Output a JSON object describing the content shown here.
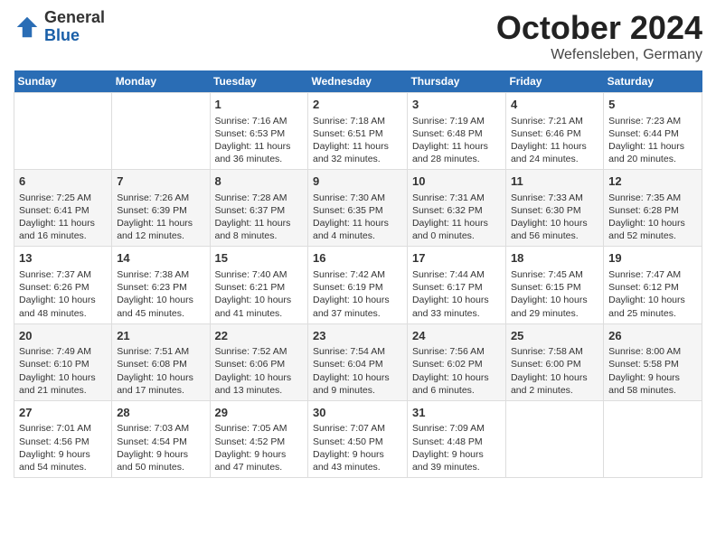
{
  "header": {
    "logo": {
      "general": "General",
      "blue": "Blue"
    },
    "title": "October 2024",
    "subtitle": "Wefensleben, Germany"
  },
  "weekdays": [
    "Sunday",
    "Monday",
    "Tuesday",
    "Wednesday",
    "Thursday",
    "Friday",
    "Saturday"
  ],
  "weeks": [
    [
      {
        "day": "",
        "info": ""
      },
      {
        "day": "",
        "info": ""
      },
      {
        "day": "1",
        "info": "Sunrise: 7:16 AM\nSunset: 6:53 PM\nDaylight: 11 hours and 36 minutes."
      },
      {
        "day": "2",
        "info": "Sunrise: 7:18 AM\nSunset: 6:51 PM\nDaylight: 11 hours and 32 minutes."
      },
      {
        "day": "3",
        "info": "Sunrise: 7:19 AM\nSunset: 6:48 PM\nDaylight: 11 hours and 28 minutes."
      },
      {
        "day": "4",
        "info": "Sunrise: 7:21 AM\nSunset: 6:46 PM\nDaylight: 11 hours and 24 minutes."
      },
      {
        "day": "5",
        "info": "Sunrise: 7:23 AM\nSunset: 6:44 PM\nDaylight: 11 hours and 20 minutes."
      }
    ],
    [
      {
        "day": "6",
        "info": "Sunrise: 7:25 AM\nSunset: 6:41 PM\nDaylight: 11 hours and 16 minutes."
      },
      {
        "day": "7",
        "info": "Sunrise: 7:26 AM\nSunset: 6:39 PM\nDaylight: 11 hours and 12 minutes."
      },
      {
        "day": "8",
        "info": "Sunrise: 7:28 AM\nSunset: 6:37 PM\nDaylight: 11 hours and 8 minutes."
      },
      {
        "day": "9",
        "info": "Sunrise: 7:30 AM\nSunset: 6:35 PM\nDaylight: 11 hours and 4 minutes."
      },
      {
        "day": "10",
        "info": "Sunrise: 7:31 AM\nSunset: 6:32 PM\nDaylight: 11 hours and 0 minutes."
      },
      {
        "day": "11",
        "info": "Sunrise: 7:33 AM\nSunset: 6:30 PM\nDaylight: 10 hours and 56 minutes."
      },
      {
        "day": "12",
        "info": "Sunrise: 7:35 AM\nSunset: 6:28 PM\nDaylight: 10 hours and 52 minutes."
      }
    ],
    [
      {
        "day": "13",
        "info": "Sunrise: 7:37 AM\nSunset: 6:26 PM\nDaylight: 10 hours and 48 minutes."
      },
      {
        "day": "14",
        "info": "Sunrise: 7:38 AM\nSunset: 6:23 PM\nDaylight: 10 hours and 45 minutes."
      },
      {
        "day": "15",
        "info": "Sunrise: 7:40 AM\nSunset: 6:21 PM\nDaylight: 10 hours and 41 minutes."
      },
      {
        "day": "16",
        "info": "Sunrise: 7:42 AM\nSunset: 6:19 PM\nDaylight: 10 hours and 37 minutes."
      },
      {
        "day": "17",
        "info": "Sunrise: 7:44 AM\nSunset: 6:17 PM\nDaylight: 10 hours and 33 minutes."
      },
      {
        "day": "18",
        "info": "Sunrise: 7:45 AM\nSunset: 6:15 PM\nDaylight: 10 hours and 29 minutes."
      },
      {
        "day": "19",
        "info": "Sunrise: 7:47 AM\nSunset: 6:12 PM\nDaylight: 10 hours and 25 minutes."
      }
    ],
    [
      {
        "day": "20",
        "info": "Sunrise: 7:49 AM\nSunset: 6:10 PM\nDaylight: 10 hours and 21 minutes."
      },
      {
        "day": "21",
        "info": "Sunrise: 7:51 AM\nSunset: 6:08 PM\nDaylight: 10 hours and 17 minutes."
      },
      {
        "day": "22",
        "info": "Sunrise: 7:52 AM\nSunset: 6:06 PM\nDaylight: 10 hours and 13 minutes."
      },
      {
        "day": "23",
        "info": "Sunrise: 7:54 AM\nSunset: 6:04 PM\nDaylight: 10 hours and 9 minutes."
      },
      {
        "day": "24",
        "info": "Sunrise: 7:56 AM\nSunset: 6:02 PM\nDaylight: 10 hours and 6 minutes."
      },
      {
        "day": "25",
        "info": "Sunrise: 7:58 AM\nSunset: 6:00 PM\nDaylight: 10 hours and 2 minutes."
      },
      {
        "day": "26",
        "info": "Sunrise: 8:00 AM\nSunset: 5:58 PM\nDaylight: 9 hours and 58 minutes."
      }
    ],
    [
      {
        "day": "27",
        "info": "Sunrise: 7:01 AM\nSunset: 4:56 PM\nDaylight: 9 hours and 54 minutes."
      },
      {
        "day": "28",
        "info": "Sunrise: 7:03 AM\nSunset: 4:54 PM\nDaylight: 9 hours and 50 minutes."
      },
      {
        "day": "29",
        "info": "Sunrise: 7:05 AM\nSunset: 4:52 PM\nDaylight: 9 hours and 47 minutes."
      },
      {
        "day": "30",
        "info": "Sunrise: 7:07 AM\nSunset: 4:50 PM\nDaylight: 9 hours and 43 minutes."
      },
      {
        "day": "31",
        "info": "Sunrise: 7:09 AM\nSunset: 4:48 PM\nDaylight: 9 hours and 39 minutes."
      },
      {
        "day": "",
        "info": ""
      },
      {
        "day": "",
        "info": ""
      }
    ]
  ]
}
